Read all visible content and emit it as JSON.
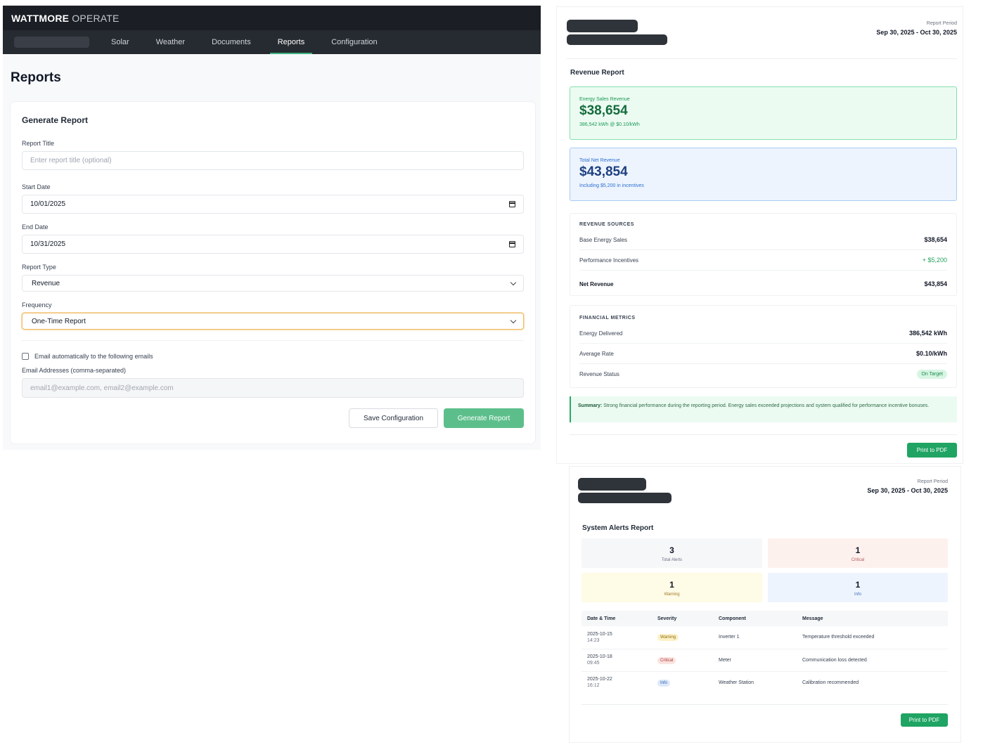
{
  "app": {
    "brand_main": "WATTMORE",
    "brand_sub": " OPERATE",
    "nav": [
      "Solar",
      "Weather",
      "Documents",
      "Reports",
      "Configuration"
    ],
    "active_nav": "Reports",
    "page_title": "Reports"
  },
  "form": {
    "title": "Generate Report",
    "report_title_label": "Report Title",
    "report_title_placeholder": "Enter report title (optional)",
    "start_date_label": "Start Date",
    "start_date_value": "10/01/2025",
    "end_date_label": "End Date",
    "end_date_value": "10/31/2025",
    "report_type_label": "Report Type",
    "report_type_value": "Revenue",
    "frequency_label": "Frequency",
    "frequency_value": "One-Time Report",
    "email_auto_label": "Email automatically to the following emails",
    "email_checked": false,
    "emails_label": "Email Addresses (comma-separated)",
    "emails_placeholder": "email1@example.com, email2@example.com",
    "save_button": "Save Configuration",
    "generate_button": "Generate Report"
  },
  "revenue_report": {
    "period_label": "Report Period",
    "period_value": "Sep 30, 2025 - Oct 30, 2025",
    "title": "Revenue Report",
    "energy_sales": {
      "label": "Energy Sales Revenue",
      "value": "$38,654",
      "sub": "386,542 kWh @ $0.10/kWh"
    },
    "net_revenue": {
      "label": "Total Net Revenue",
      "value": "$43,854",
      "sub": "Including $5,200 in incentives"
    },
    "sources": {
      "title": "REVENUE SOURCES",
      "rows": [
        {
          "label": "Base Energy Sales",
          "value": "$38,654"
        },
        {
          "label": "Performance Incentives",
          "value": "+ $5,200"
        },
        {
          "label": "Net Revenue",
          "value": "$43,854"
        }
      ]
    },
    "metrics": {
      "title": "FINANCIAL METRICS",
      "rows": [
        {
          "label": "Energy Delivered",
          "value": "386,542 kWh"
        },
        {
          "label": "Average Rate",
          "value": "$0.10/kWh"
        },
        {
          "label": "Revenue Status",
          "value": "On Target"
        }
      ]
    },
    "summary_label": "Summary:",
    "summary_text": " Strong financial performance during the reporting period. Energy sales exceeded projections and system qualified for performance incentive bonuses.",
    "print_button": "Print to PDF",
    "colors": {
      "accent": "#1fa463",
      "green_box": "#ecfbf2",
      "blue_box": "#edf4fe"
    }
  },
  "alerts_report": {
    "period_label": "Report Period",
    "period_value": "Sep 30, 2025 - Oct 30, 2025",
    "title": "System Alerts Report",
    "totals": [
      {
        "count": "3",
        "label": "Total Alerts"
      },
      {
        "count": "1",
        "label": "Critical"
      },
      {
        "count": "1",
        "label": "Warning"
      },
      {
        "count": "1",
        "label": "Info"
      }
    ],
    "columns": [
      "Date & Time",
      "Severity",
      "Component",
      "Message"
    ],
    "rows": [
      {
        "date": "2025-10-15",
        "time": "14:23",
        "severity": "Warning",
        "component": "Inverter 1",
        "message": "Temperature threshold exceeded"
      },
      {
        "date": "2025-10-18",
        "time": "09:45",
        "severity": "Critical",
        "component": "Meter",
        "message": "Communication loss detected"
      },
      {
        "date": "2025-10-22",
        "time": "16:12",
        "severity": "Info",
        "component": "Weather Station",
        "message": "Calibration recommended"
      }
    ],
    "print_button": "Print to PDF"
  }
}
